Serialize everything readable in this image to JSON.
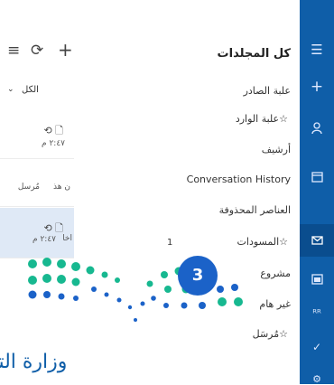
{
  "toolbar": {
    "new_icon": "+",
    "sync_icon": "⟳",
    "filter_icon": "≡"
  },
  "list": {
    "filter_label": "الكل",
    "items": [
      {
        "time": "٢:٤٧ م",
        "icons": "⟲ 🗋",
        "sender": "",
        "preview": ""
      },
      {
        "time": "",
        "icons": "",
        "sender": "مُرسل",
        "preview": "ن هذ"
      },
      {
        "time": "٢:٤٧ م",
        "icons": "⟲ 🗋",
        "sender": "اخا",
        "preview": ""
      }
    ]
  },
  "folders": {
    "header": "كل المجلدات",
    "items": [
      {
        "label": "علبة الصادر",
        "star": false,
        "count": ""
      },
      {
        "label": "علبة الوارد",
        "star": true,
        "count": ""
      },
      {
        "label": "أرشيف",
        "star": false,
        "count": ""
      },
      {
        "label": "Conversation History",
        "star": false,
        "count": ""
      },
      {
        "label": "العناصر المحذوفة",
        "star": false,
        "count": ""
      },
      {
        "label": "المسودات",
        "star": true,
        "count": "1"
      },
      {
        "label": "مشروع",
        "star": false,
        "count": ""
      },
      {
        "label": "غير هام",
        "star": false,
        "count": ""
      },
      {
        "label": "مُرسَل",
        "star": true,
        "count": ""
      }
    ]
  },
  "star_glyph": "☆",
  "overlay": {
    "badge": "3",
    "ministry_text": "وزارة التـ"
  },
  "colors": {
    "rail": "#0f5ea8",
    "selected_row": "#dfe9f6",
    "badge": "#1b62c8",
    "dots_green": "#17b890",
    "dots_blue": "#1b62c8"
  }
}
